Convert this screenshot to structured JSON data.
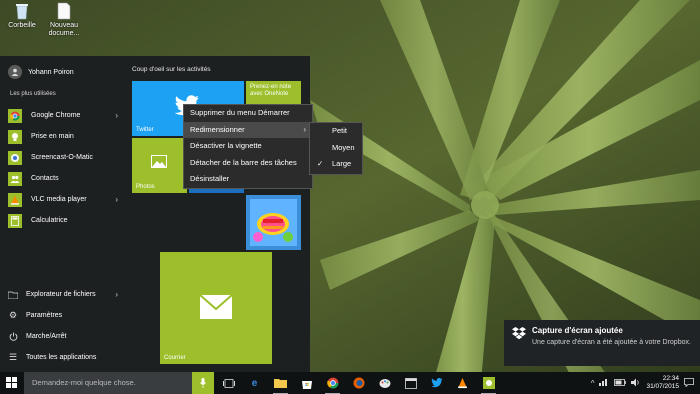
{
  "desktop": {
    "icons": [
      {
        "label": "Corbeille",
        "icon": "recycle-bin-icon"
      },
      {
        "label": "Nouveau docume...",
        "icon": "text-document-icon"
      }
    ]
  },
  "start_menu": {
    "user_name": "Yohann Poiron",
    "most_used_title": "Les plus utilisées",
    "apps": [
      {
        "label": "Google Chrome",
        "has_submenu": true,
        "icon": "chrome-icon"
      },
      {
        "label": "Prise en main",
        "has_submenu": false,
        "icon": "lightbulb-icon"
      },
      {
        "label": "Screencast-O-Matic",
        "has_submenu": false,
        "icon": "screencast-icon"
      },
      {
        "label": "Contacts",
        "has_submenu": false,
        "icon": "contacts-icon"
      },
      {
        "label": "VLC media player",
        "has_submenu": true,
        "icon": "vlc-icon"
      },
      {
        "label": "Calculatrice",
        "has_submenu": false,
        "icon": "calculator-icon"
      }
    ],
    "bottom": {
      "explorer_label": "Explorateur de fichiers",
      "settings_label": "Paramètres",
      "power_label": "Marche/Arrêt",
      "all_apps_label": "Toutes les applications"
    },
    "tiles_title": "Coup d'oeil sur les activités",
    "tiles": {
      "twitter_label": "Twitter",
      "onenote_text": "Prenez-en note avec OneNote",
      "photos_label": "Photos",
      "courrier_label": "Courrier"
    }
  },
  "context_menu": {
    "items": [
      {
        "label": "Supprimer du menu Démarrer",
        "has_submenu": false
      },
      {
        "label": "Redimensionner",
        "has_submenu": true,
        "active": true
      },
      {
        "label": "Désactiver la vignette",
        "has_submenu": false
      },
      {
        "label": "Détacher de la barre des tâches",
        "has_submenu": false
      },
      {
        "label": "Désinstaller",
        "has_submenu": false
      }
    ]
  },
  "resize_menu": {
    "items": [
      {
        "label": "Petit",
        "checked": false
      },
      {
        "label": "Moyen",
        "checked": false
      },
      {
        "label": "Large",
        "checked": true
      }
    ]
  },
  "taskbar": {
    "search_placeholder": "Demandez-moi quelque chose.",
    "icons": [
      "task-view-icon",
      "edge-icon",
      "file-explorer-icon",
      "store-icon",
      "chrome-icon",
      "firefox-icon",
      "paint-icon",
      "calendar-icon",
      "twitter-icon",
      "vlc-icon",
      "screencast-icon"
    ],
    "tray_icons": [
      "chevron-up-icon",
      "network-icon",
      "battery-icon",
      "volume-icon",
      "notification-icon"
    ],
    "time": "22:34",
    "date": "31/07/2015"
  },
  "notification": {
    "title": "Capture d'écran ajoutée",
    "body": "Une capture d'écran a été ajoutée à votre Dropbox.",
    "icon": "dropbox-icon"
  },
  "colors": {
    "accent_green": "#9cbf2b",
    "twitter_blue": "#1da1f2",
    "taskbar": "#0f1213",
    "start_bg": "#1d2021"
  }
}
